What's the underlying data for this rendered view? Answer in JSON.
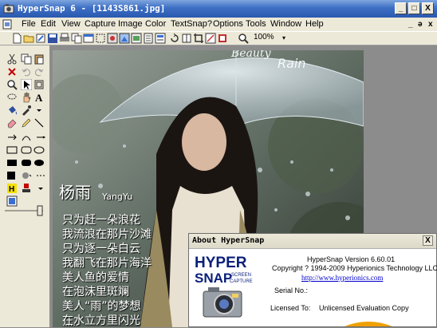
{
  "window": {
    "title": "HyperSnap 6 - [1143S861.jpg]",
    "minimize": "_",
    "maximize": "□",
    "close": "X"
  },
  "menu": {
    "items": [
      "File",
      "Edit",
      "View",
      "Capture",
      "Image",
      "Color",
      "TextSnap?",
      "Options",
      "Tools",
      "Window",
      "Help"
    ],
    "mdi_minimize": "_",
    "mdi_restore": "ə",
    "mdi_close": "x"
  },
  "toolbar": {
    "zoom_value": "100%",
    "zoom_dropdown": "▾"
  },
  "image": {
    "overlay_title_1": "Beauty",
    "overlay_title_2": "Rain",
    "name_cn": "杨雨",
    "name_pinyin": "YangYu",
    "poem": [
      "只为赶一朵浪花",
      "我流浪在那片沙滩",
      "只为逐一朵白云",
      "我翻飞在那片海洋",
      "美人鱼的爱情",
      "在泡沫里斑斓",
      "美人“雨”的梦想",
      "在水立方里闪光",
      "……"
    ],
    "accent_color": "#b0d8f0"
  },
  "about_dialog": {
    "title": "About HyperSnap",
    "close": "X",
    "logo_word": "HYPER",
    "logo_word_2": "SNAP",
    "logo_sub_1": "SCREEN",
    "logo_sub_2": "CAPTURE",
    "version": "HyperSnap Version 6.60.01",
    "copyright": "Copyright ? 1994-2009 Hyperionics Technology LLC",
    "website": "http://www.hyperionics.com",
    "serial_label": "Serial No.:",
    "licensed_label": "Licensed To:",
    "licensed_value": "Unlicensed Evaluation Copy"
  }
}
